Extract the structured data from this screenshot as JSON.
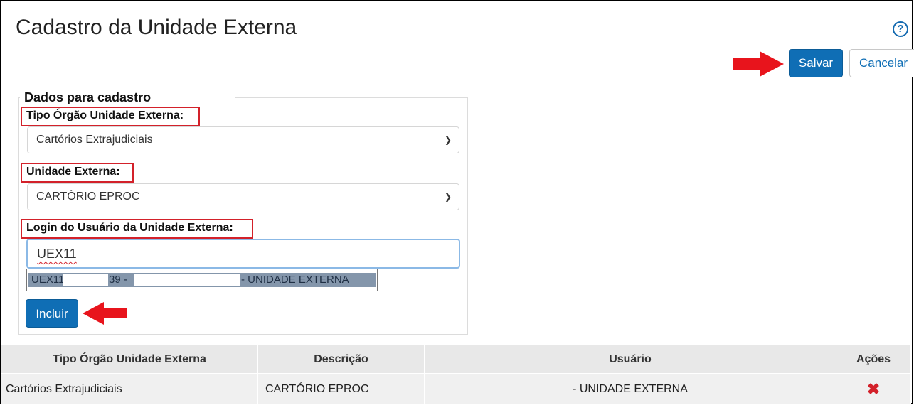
{
  "page": {
    "title": "Cadastro da Unidade Externa",
    "help_icon": "question-circle-icon"
  },
  "toolbar": {
    "save_prefix": "S",
    "save_rest": "alvar",
    "cancel_prefix": "C",
    "cancel_rest": "ancelar"
  },
  "form": {
    "legend": "Dados para cadastro",
    "tipo_label": "Tipo Órgão Unidade Externa:",
    "tipo_value": "Cartórios Extrajudiciais",
    "unidade_label": "Unidade Externa:",
    "unidade_value": "CARTÓRIO EPROC",
    "login_label": "Login do Usuário da Unidade Externa:",
    "login_value": "UEX11",
    "suggestion": {
      "part1": "UEX11",
      "part2": "39 -",
      "part3": "- UNIDADE EXTERNA"
    },
    "include_label": "Incluir"
  },
  "table": {
    "headers": [
      "Tipo Órgão Unidade Externa",
      "Descrição",
      "Usuário",
      "Ações"
    ],
    "rows": [
      {
        "tipo": "Cartórios Extrajudiciais",
        "descricao": "CARTÓRIO EPROC",
        "usuario": "- UNIDADE EXTERNA",
        "acao_icon": "delete-x-icon"
      }
    ]
  },
  "colors": {
    "primary": "#0f6eb5",
    "highlight": "#d3212a",
    "arrow": "#e8141c"
  }
}
